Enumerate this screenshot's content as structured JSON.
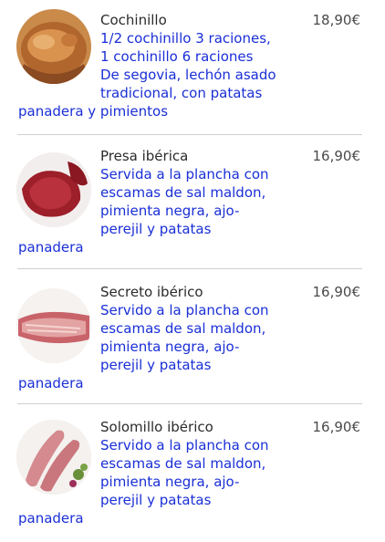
{
  "menu": {
    "items": [
      {
        "name": "Cochinillo",
        "price": "18,90€",
        "desc_lines": [
          "1/2 cochinillo 3 raciones,",
          "1 cochinillo 6 raciones",
          "De segovia, lechón asado",
          "tradicional, con patatas"
        ],
        "desc_tail": "panadera y pimientos",
        "image_icon": "roast-piglet-photo"
      },
      {
        "name": "Presa ibérica",
        "price": "16,90€",
        "desc_lines": [
          "Servida a la plancha con",
          "escamas de sal maldon,",
          "pimienta negra, ajo-",
          "perejil y patatas"
        ],
        "desc_tail": "panadera",
        "image_icon": "raw-pork-cut-photo"
      },
      {
        "name": "Secreto ibérico",
        "price": "16,90€",
        "desc_lines": [
          "Servido a la plancha con",
          "escamas de sal maldon,",
          "pimienta negra, ajo-",
          "perejil y patatas"
        ],
        "desc_tail": "panadera",
        "image_icon": "raw-pork-secreto-photo"
      },
      {
        "name": "Solomillo ibérico",
        "price": "16,90€",
        "desc_lines": [
          "Servido a la plancha con",
          "escamas de sal maldon,",
          "pimienta negra, ajo-",
          "perejil y patatas"
        ],
        "desc_tail": "panadera",
        "image_icon": "pork-tenderloin-photo"
      }
    ]
  },
  "colors": {
    "title": "#2b2b2b",
    "price": "#4a4a4a",
    "description": "#1a2fd6",
    "separator": "#cfcfcf"
  }
}
